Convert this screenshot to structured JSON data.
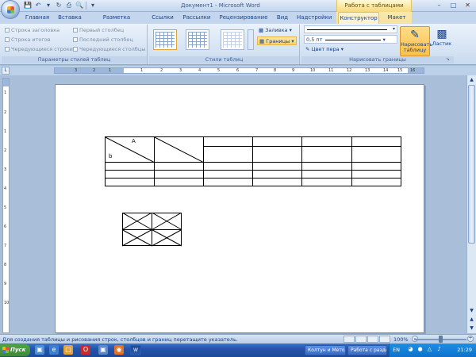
{
  "titlebar": {
    "document_title": "Документ1 - Microsoft Word",
    "context_tab_title": "Работа с таблицами"
  },
  "tabs": [
    {
      "label": "Главная"
    },
    {
      "label": "Вставка"
    },
    {
      "label": "Разметка страницы"
    },
    {
      "label": "Ссылки"
    },
    {
      "label": "Рассылки"
    },
    {
      "label": "Рецензирование"
    },
    {
      "label": "Вид"
    },
    {
      "label": "Надстройки"
    },
    {
      "label": "Конструктор"
    },
    {
      "label": "Макет"
    }
  ],
  "active_tab": "Конструктор",
  "ribbon": {
    "style_options": {
      "label": "Параметры стилей таблиц",
      "checkboxes": [
        {
          "label": "Строка заголовка",
          "checked": false
        },
        {
          "label": "Первый столбец",
          "checked": false
        },
        {
          "label": "Строка итогов",
          "checked": false
        },
        {
          "label": "Последний столбец",
          "checked": false
        },
        {
          "label": "Чередующиеся строки",
          "checked": false
        },
        {
          "label": "Чередующиеся столбцы",
          "checked": false
        }
      ]
    },
    "table_styles": {
      "label": "Стили таблиц",
      "shading_label": "Заливка",
      "borders_label": "Границы"
    },
    "draw_borders": {
      "label": "Нарисовать границы",
      "pen_weight": "0,5 пт",
      "pen_color_label": "Цвет пера",
      "draw_table_label": "Нарисовать таблицу",
      "eraser_label": "Ластик"
    }
  },
  "ruler": {
    "h_ticks": [
      "3",
      "2",
      "1",
      "1",
      "2",
      "3",
      "4",
      "5",
      "6",
      "7",
      "8",
      "9",
      "10",
      "11",
      "12",
      "13",
      "14",
      "15",
      "16"
    ],
    "v_ticks": [
      "1",
      "2",
      "1",
      "2",
      "3",
      "4",
      "5",
      "6",
      "7",
      "8",
      "9",
      "10"
    ]
  },
  "document": {
    "table1": {
      "header_top_right": "A",
      "header_bottom_left": "b"
    }
  },
  "statusbar": {
    "text": "Для создания таблицы и рисования строк, столбцов и границ перетащите указатель.",
    "zoom": "100%"
  },
  "taskbar": {
    "start_label": "Пуск",
    "task_label": "Колтун и Методы ...",
    "task2_label": "Работа с разделами",
    "lang": "EN",
    "clock": "21:29"
  }
}
